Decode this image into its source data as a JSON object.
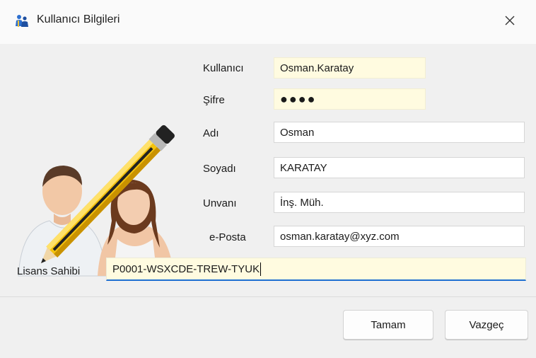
{
  "window": {
    "title": "Kullanıcı Bilgileri",
    "icon": "users-icon",
    "close_icon": "close-icon"
  },
  "illustration": {
    "icon": "user-edit-icon"
  },
  "form": {
    "kullanici": {
      "label": "Kullanıcı",
      "value": "Osman.Karatay"
    },
    "sifre": {
      "label": "Şifre",
      "value": "●●●●"
    },
    "adi": {
      "label": "Adı",
      "value": "Osman"
    },
    "soyadi": {
      "label": "Soyadı",
      "value": "KARATAY"
    },
    "unvani": {
      "label": "Unvanı",
      "value": "İnş. Müh."
    },
    "eposta": {
      "label": "e-Posta",
      "value": "osman.karatay@xyz.com"
    },
    "lisans": {
      "label": "Lisans Sahibi",
      "value": "P0001-WSXCDE-TREW-TYUK"
    }
  },
  "buttons": {
    "ok_label": "Tamam",
    "cancel_label": "Vazgeç"
  },
  "colors": {
    "required_field_bg": "#fffbe0",
    "focus_underline": "#1f6fd1"
  }
}
